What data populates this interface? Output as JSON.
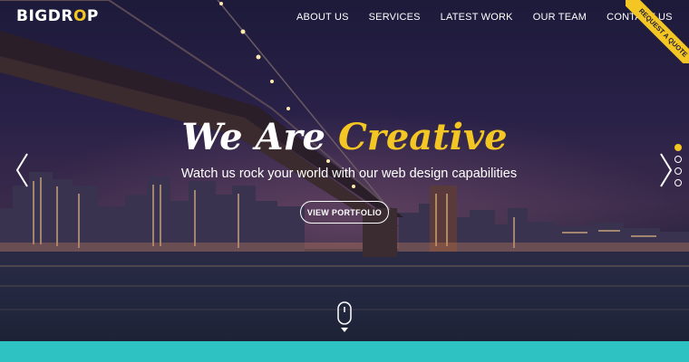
{
  "brand": {
    "logo_left": "BIGDR",
    "logo_o": "O",
    "logo_right": "P"
  },
  "nav": {
    "items": [
      {
        "label": "ABOUT US"
      },
      {
        "label": "SERVICES"
      },
      {
        "label": "LATEST WORK"
      },
      {
        "label": "OUR TEAM"
      },
      {
        "label": "CONTACT US"
      }
    ]
  },
  "ribbon": {
    "label": "REQUEST A QUOTE"
  },
  "hero": {
    "headline_part1": "We Are ",
    "headline_part2": "Creative",
    "subline": "Watch us rock your world with our web design capabilities",
    "cta_label": "VIEW PORTFOLIO"
  },
  "slider": {
    "slide_count": 4,
    "active_index": 0
  },
  "icons": {
    "prev": "chevron-left-icon",
    "next": "chevron-right-icon",
    "scroll": "mouse-scroll-icon"
  },
  "colors": {
    "accent": "#f3c623",
    "band": "#2fc2c2",
    "sky": "#2a2148"
  }
}
